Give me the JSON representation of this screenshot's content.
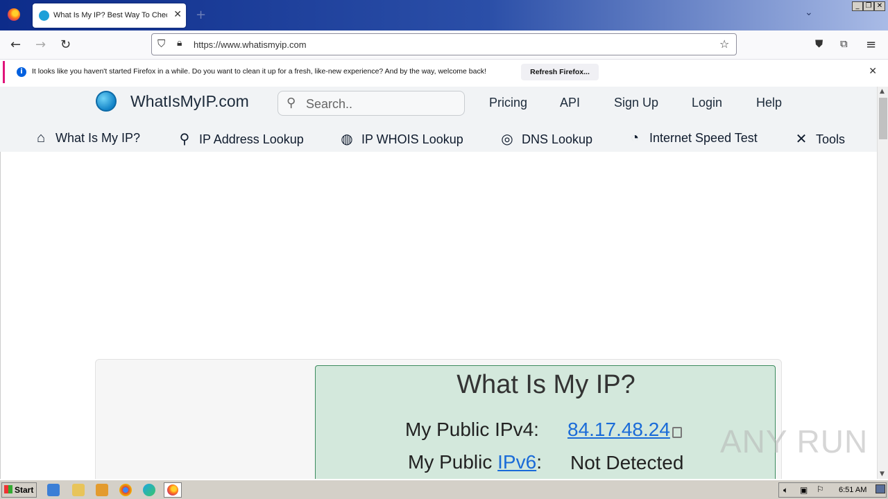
{
  "browser": {
    "tab_title": "What Is My IP? Best Way To Check Your Public IP Address",
    "url": "https://www.whatismyip.com",
    "notification_text": "It looks like you haven't started Firefox in a while. Do you want to clean it up for a fresh, like-new experience? And by the way, welcome back!",
    "notification_button": "Refresh Firefox..."
  },
  "site": {
    "logo": "WhatIsMyIP.com",
    "search_placeholder": "Search..",
    "top_nav": [
      "Pricing",
      "API",
      "Sign Up",
      "Login",
      "Help"
    ],
    "main_nav": [
      {
        "label": "What Is My IP?",
        "icon": "home-icon"
      },
      {
        "label": "IP Address Lookup",
        "icon": "map-pin-icon"
      },
      {
        "label": "IP WHOIS Lookup",
        "icon": "globe-icon"
      },
      {
        "label": "DNS Lookup",
        "icon": "dns-icon"
      },
      {
        "label": "Internet Speed Test",
        "icon": "speedometer-icon"
      },
      {
        "label": "Tools",
        "icon": "tools-icon"
      }
    ]
  },
  "ip_box": {
    "title": "What Is My IP?",
    "ipv4_label": "My Public IPv4:",
    "ipv4_value": "84.17.48.24",
    "ipv6_label_prefix": "My Public ",
    "ipv6_link": "IPv6",
    "ipv6_label_suffix": ":",
    "ipv6_value": "Not Detected"
  },
  "watermark": "ANY RUN",
  "taskbar": {
    "start_label": "Start",
    "clock": "6:51 AM"
  }
}
